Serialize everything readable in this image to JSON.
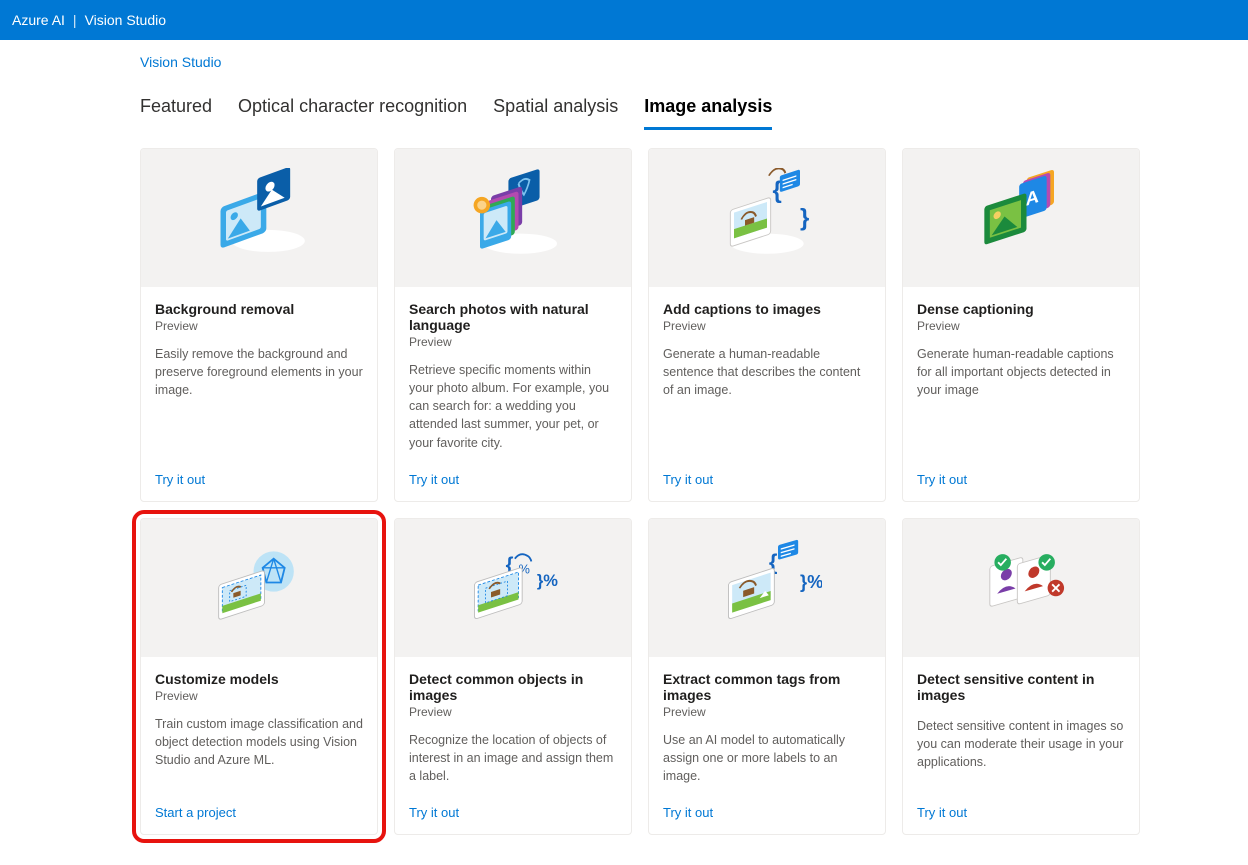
{
  "header": {
    "brand": "Azure AI",
    "product": "Vision Studio"
  },
  "breadcrumb": {
    "label": "Vision Studio"
  },
  "tabs": [
    {
      "label": "Featured",
      "active": false
    },
    {
      "label": "Optical character recognition",
      "active": false
    },
    {
      "label": "Spatial analysis",
      "active": false
    },
    {
      "label": "Image analysis",
      "active": true
    }
  ],
  "cards": [
    {
      "title": "Background removal",
      "subtitle": "Preview",
      "description": "Easily remove the background and preserve foreground elements in your image.",
      "action": "Try it out",
      "highlight": false
    },
    {
      "title": "Search photos with natural language",
      "subtitle": "Preview",
      "description": "Retrieve specific moments within your photo album. For example, you can search for: a wedding you attended last summer, your pet, or your favorite city.",
      "action": "Try it out",
      "highlight": false
    },
    {
      "title": "Add captions to images",
      "subtitle": "Preview",
      "description": "Generate a human-readable sentence that describes the content of an image.",
      "action": "Try it out",
      "highlight": false
    },
    {
      "title": "Dense captioning",
      "subtitle": "Preview",
      "description": "Generate human-readable captions for all important objects detected in your image",
      "action": "Try it out",
      "highlight": false
    },
    {
      "title": "Customize models",
      "subtitle": "Preview",
      "description": "Train custom image classification and object detection models using Vision Studio and Azure ML.",
      "action": "Start a project",
      "highlight": true
    },
    {
      "title": "Detect common objects in images",
      "subtitle": "Preview",
      "description": "Recognize the location of objects of interest in an image and assign them a label.",
      "action": "Try it out",
      "highlight": false
    },
    {
      "title": "Extract common tags from images",
      "subtitle": "Preview",
      "description": "Use an AI model to automatically assign one or more labels to an image.",
      "action": "Try it out",
      "highlight": false
    },
    {
      "title": "Detect sensitive content in images",
      "subtitle": "",
      "description": "Detect sensitive content in images so you can moderate their usage in your applications.",
      "action": "Try it out",
      "highlight": false
    }
  ]
}
